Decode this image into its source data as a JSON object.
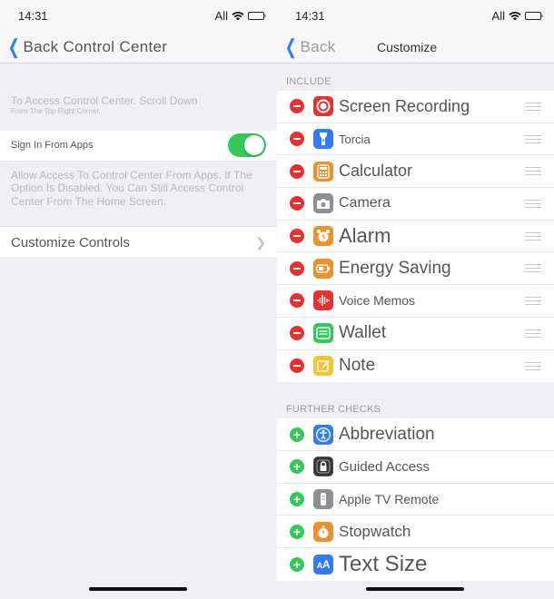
{
  "left": {
    "status": {
      "time": "14:31",
      "carrier": "All"
    },
    "nav": {
      "back_label": "Back Control Center"
    },
    "intro": {
      "line1": "To Access Control Center. Scroll Down",
      "line2": "From The Top Right Corner."
    },
    "signin": {
      "label": "Sign In From Apps",
      "toggle_on": true
    },
    "signin_footer": "Allow Access To Control Center From Apps. If The Option Is Disabled. You Can Still Access Control Center From The Home Screen.",
    "customize": {
      "label": "Customize Controls"
    }
  },
  "right": {
    "status": {
      "time": "14:31",
      "carrier": "All"
    },
    "nav": {
      "back_label": "Back",
      "title": "Customize"
    },
    "include_header": "INCLUDE",
    "include": [
      {
        "label": "Screen Recording",
        "icon": "screen-recording-icon",
        "color": "#e8312f",
        "size": 18
      },
      {
        "label": "Torcia",
        "icon": "flashlight-icon",
        "color": "#2f7cf6",
        "size": 13
      },
      {
        "label": "Calculator",
        "icon": "calculator-icon",
        "color": "#f0902a",
        "size": 18
      },
      {
        "label": "Camera",
        "icon": "camera-icon",
        "color": "#8e8e93",
        "size": 16
      },
      {
        "label": "Alarm",
        "icon": "alarm-icon",
        "color": "#f0902a",
        "size": 22
      },
      {
        "label": "Energy Saving",
        "icon": "battery-icon",
        "color": "#f0902a",
        "size": 19
      },
      {
        "label": "Voice Memos",
        "icon": "voice-memos-icon",
        "color": "#e8312f",
        "size": 14
      },
      {
        "label": "Wallet",
        "icon": "wallet-icon",
        "color": "#34c759",
        "size": 19
      },
      {
        "label": "Note",
        "icon": "note-icon",
        "color": "#f4c430",
        "size": 19
      }
    ],
    "further_header": "FURTHER CHECKS",
    "further": [
      {
        "label": "Abbreviation",
        "icon": "accessibility-icon",
        "color": "#2f7cf6",
        "size": 19
      },
      {
        "label": "Guided Access",
        "icon": "guided-access-icon",
        "color": "#333333",
        "size": 15
      },
      {
        "label": "Apple TV Remote",
        "icon": "tv-remote-icon",
        "color": "#8e8e93",
        "size": 14
      },
      {
        "label": "Stopwatch",
        "icon": "stopwatch-icon",
        "color": "#f0902a",
        "size": 17
      },
      {
        "label": "Text Size",
        "icon": "text-size-icon",
        "color": "#2f7cf6",
        "size": 24
      }
    ]
  }
}
